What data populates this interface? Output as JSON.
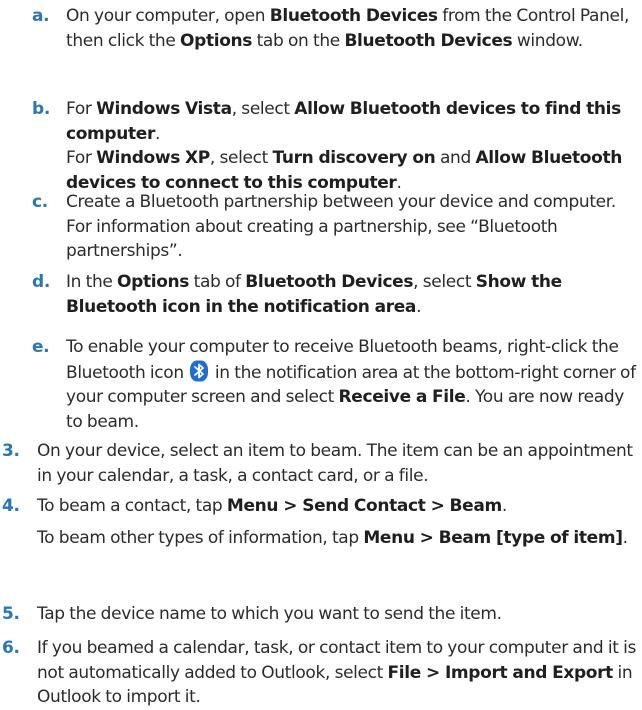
{
  "steps": {
    "a": {
      "marker": "a.",
      "t1": "On your computer, open ",
      "b1": "Bluetooth Devices",
      "t2": " from the Control Panel, then click the ",
      "b2": "Options",
      "t3": " tab on the ",
      "b3": "Bluetooth Devices",
      "t4": " window."
    },
    "b": {
      "marker": "b.",
      "t1": "For ",
      "b1": "Windows Vista",
      "t2": ", select ",
      "b2": "Allow Bluetooth devices to find this computer",
      "t3": ".",
      "t4": "For ",
      "b3": "Windows XP",
      "t5": ", select ",
      "b4": "Turn discovery on",
      "t6": " and ",
      "b5": "Allow Bluetooth devices to connect to this computer",
      "t7": "."
    },
    "c": {
      "marker": "c.",
      "t1": "Create a Bluetooth partnership between your device and computer. For information about creating a partnership, see “Bluetooth partnerships”."
    },
    "d": {
      "marker": "d.",
      "t1": "In the ",
      "b1": "Options",
      "t2": " tab of ",
      "b2": "Bluetooth Devices",
      "t3": ", select ",
      "b3": "Show the Bluetooth icon in the notification area",
      "t4": "."
    },
    "e": {
      "marker": "e.",
      "t1": "To enable your computer to receive Bluetooth beams, right-click the Bluetooth icon ",
      "icon": "bluetooth-icon",
      "t2": " in the notification area at the bottom-right corner of your computer screen and select ",
      "b1": "Receive a File",
      "t3": ". You are now ready to beam."
    },
    "s3": {
      "marker": "3.",
      "t1": "On your device, select an item to beam. The item can be an appointment in your calendar, a task, a contact card, or a file."
    },
    "s4": {
      "marker": "4.",
      "t1": "To beam a contact, tap ",
      "b1": "Menu > Send Contact > Beam",
      "t2": ".",
      "t3": "To beam other types of information, tap ",
      "b2": "Menu > Beam [type of item]",
      "t4": "."
    },
    "s5": {
      "marker": "5.",
      "t1": "Tap the device name to which you want to send the item."
    },
    "s6": {
      "marker": "6.",
      "t1": "If you beamed a calendar, task, or contact item to your computer and it is not automatically added to Outlook, select ",
      "b1": "File > Import and Export",
      "t2": " in Outlook to import it."
    }
  },
  "colors": {
    "marker": "#2877b8",
    "text": "#2b2b2b",
    "bluetooth": "#1e6fd0"
  }
}
